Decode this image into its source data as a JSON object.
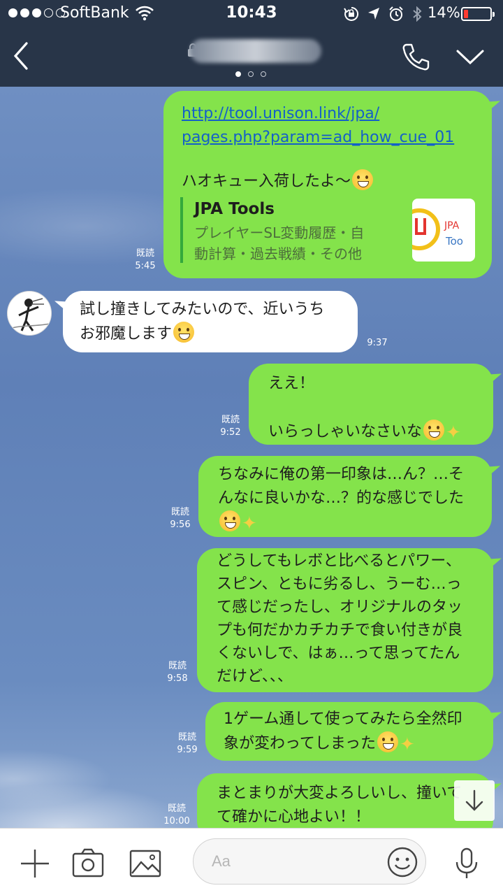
{
  "status_bar": {
    "carrier": "SoftBank",
    "time": "10:43",
    "battery_percent": "14%",
    "icons": [
      "wifi-icon",
      "rotation-lock-icon",
      "location-icon",
      "alarm-icon",
      "bluetooth-icon",
      "battery-icon"
    ]
  },
  "header": {
    "title": "",
    "page_indicator": {
      "count": 3,
      "active": 1
    },
    "icons": [
      "back-icon",
      "lock-icon",
      "phone-icon",
      "chevron-down-icon"
    ]
  },
  "messages": [
    {
      "direction": "outgoing",
      "link_lines": [
        "http://tool.unison.link/jpa/",
        "pages.php?param=ad_how_cue_01"
      ],
      "text_lines": [
        "ハオキュー入荷したよ〜"
      ],
      "text_emoji": "kiss-emoji",
      "preview": {
        "title": "JPA Tools",
        "description_lines": [
          "プレイヤーSL変動履歴・自",
          "動計算・過去戦績・その他"
        ],
        "thumb_text_1": "JPA",
        "thumb_text_2": "Too"
      },
      "read": "既読",
      "time": "5:45"
    },
    {
      "direction": "incoming",
      "text_lines": [
        "試し撞きしてみたいので、近いうち",
        "お邪魔します"
      ],
      "emoji": [
        "grin-emoji"
      ],
      "time": "9:37"
    },
    {
      "direction": "outgoing",
      "text_lines": [
        "ええ！",
        "",
        "いらっしゃいなさいな"
      ],
      "emoji": [
        "grin-emoji",
        "sparkles-emoji"
      ],
      "read": "既読",
      "time": "9:52"
    },
    {
      "direction": "outgoing",
      "text_lines": [
        "ちなみに俺の第一印象は…ん？…そ",
        "んなに良いかな…？的な感じでした"
      ],
      "emoji": [
        "blush-emoji",
        "sparkles-emoji"
      ],
      "read": "既読",
      "time": "9:56"
    },
    {
      "direction": "outgoing",
      "text_lines": [
        "どうしてもレボと比べるとパワー、",
        "スピン、ともに劣るし、うーむ…っ",
        "て感じだったし、オリジナルのタッ",
        "プも何だかカチカチで食い付きが良",
        "くないしで、はぁ…って思ってたん",
        "だけど、、、"
      ],
      "read": "既読",
      "time": "9:58"
    },
    {
      "direction": "outgoing",
      "text_lines": [
        "1ゲーム通して使ってみたら全然印",
        "象が変わってしまった"
      ],
      "emoji": [
        "grin-emoji",
        "sparkles-emoji"
      ],
      "read": "既読",
      "time": "9:59"
    },
    {
      "direction": "outgoing",
      "text_lines": [
        "まとまりが大変よろしいし、撞いて",
        "て確かに心地よい！！"
      ],
      "read": "既読",
      "time": "10:00"
    }
  ],
  "scroll_button": {
    "icon": "arrow-down-icon"
  },
  "input_bar": {
    "placeholder": "Aa",
    "value": "",
    "icons": [
      "plus-icon",
      "camera-icon",
      "image-icon",
      "emoji-icon",
      "microphone-icon"
    ]
  },
  "colors": {
    "header_bg": "#283548",
    "outgoing_bubble": "#84e34b",
    "incoming_bubble": "#ffffff",
    "chat_bg": "#5f80b7",
    "link": "#1460c8",
    "preview_bar": "#34a93c"
  }
}
